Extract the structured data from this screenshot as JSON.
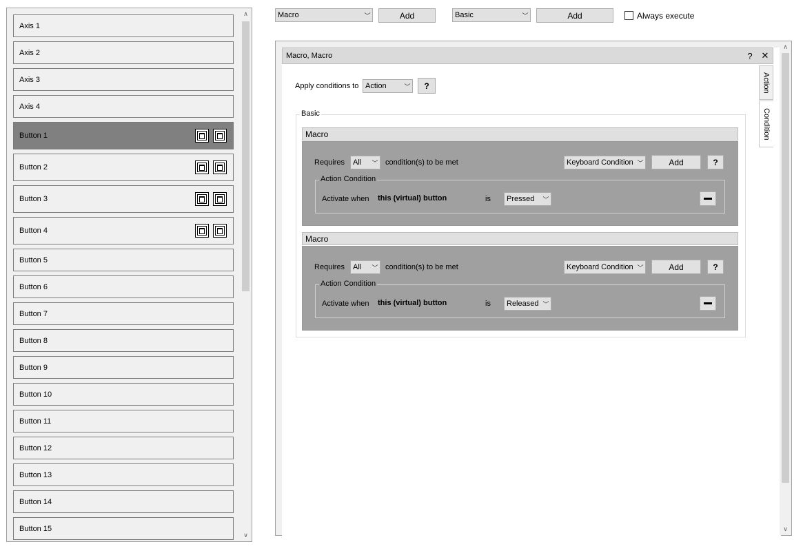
{
  "left_list": {
    "items": [
      {
        "label": "Axis 1",
        "icons": false,
        "selected": false
      },
      {
        "label": "Axis 2",
        "icons": false,
        "selected": false
      },
      {
        "label": "Axis 3",
        "icons": false,
        "selected": false
      },
      {
        "label": "Axis 4",
        "icons": false,
        "selected": false
      },
      {
        "label": "Button 1",
        "icons": true,
        "selected": true
      },
      {
        "label": "Button 2",
        "icons": true,
        "selected": false
      },
      {
        "label": "Button 3",
        "icons": true,
        "selected": false
      },
      {
        "label": "Button 4",
        "icons": true,
        "selected": false
      },
      {
        "label": "Button 5",
        "icons": false,
        "selected": false
      },
      {
        "label": "Button 6",
        "icons": false,
        "selected": false
      },
      {
        "label": "Button 7",
        "icons": false,
        "selected": false
      },
      {
        "label": "Button 8",
        "icons": false,
        "selected": false
      },
      {
        "label": "Button 9",
        "icons": false,
        "selected": false
      },
      {
        "label": "Button 10",
        "icons": false,
        "selected": false
      },
      {
        "label": "Button 11",
        "icons": false,
        "selected": false
      },
      {
        "label": "Button 12",
        "icons": false,
        "selected": false
      },
      {
        "label": "Button 13",
        "icons": false,
        "selected": false
      },
      {
        "label": "Button 14",
        "icons": false,
        "selected": false
      },
      {
        "label": "Button 15",
        "icons": false,
        "selected": false
      }
    ]
  },
  "toolbar": {
    "action_select": "Macro",
    "add_action_label": "Add",
    "container_select": "Basic",
    "add_container_label": "Add",
    "always_execute_label": "Always execute",
    "always_execute_checked": false
  },
  "action_panel": {
    "title": "Macro, Macro",
    "help_icon": "?",
    "close_icon": "✕",
    "tabs": [
      "Action",
      "Condition"
    ],
    "active_tab": "Condition",
    "apply_conditions_label": "Apply conditions to",
    "apply_conditions_value": "Action",
    "apply_help": "?",
    "group_title": "Basic",
    "blocks": [
      {
        "header": "Macro",
        "requires_label": "Requires",
        "requires_value": "All",
        "condition_text": "condition(s) to be met",
        "condition_type": "Keyboard Condition",
        "add_label": "Add",
        "help": "?",
        "inner_title": "Action Condition",
        "activate_label": "Activate when",
        "subject": "this (virtual) button",
        "is_label": "is",
        "state": "Pressed"
      },
      {
        "header": "Macro",
        "requires_label": "Requires",
        "requires_value": "All",
        "condition_text": "condition(s) to be met",
        "condition_type": "Keyboard Condition",
        "add_label": "Add",
        "help": "?",
        "inner_title": "Action Condition",
        "activate_label": "Activate when",
        "subject": "this (virtual) button",
        "is_label": "is",
        "state": "Released"
      }
    ]
  },
  "icons": {
    "chevron_down": "﹀",
    "scroll_up": "∧",
    "scroll_down": "∨"
  }
}
